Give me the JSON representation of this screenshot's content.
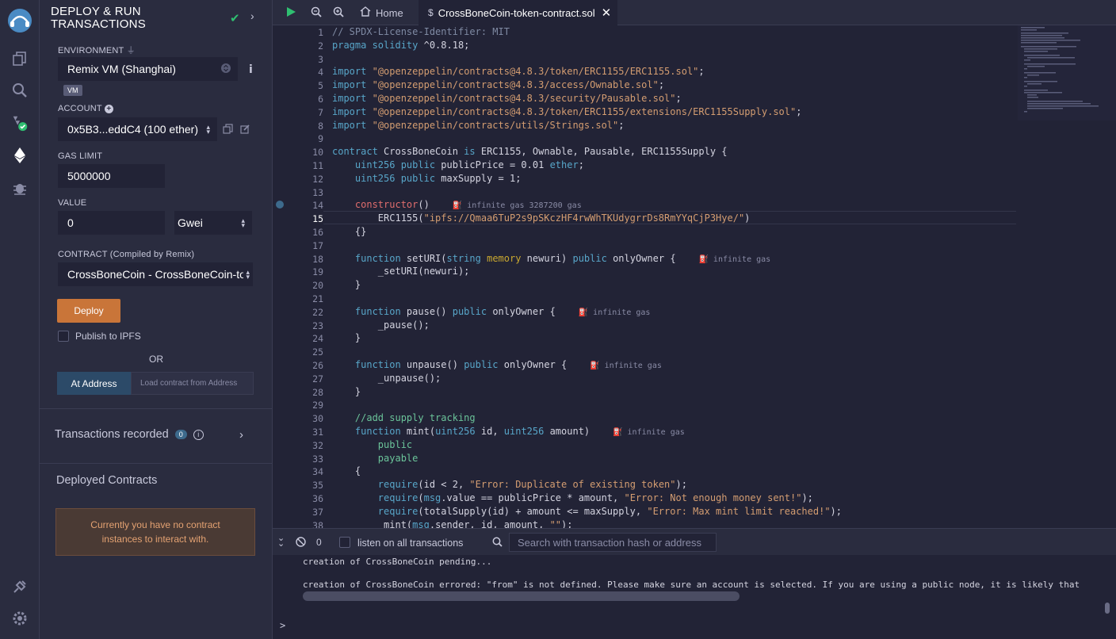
{
  "sidepanel": {
    "title_line1": "DEPLOY & RUN",
    "title_line2": "TRANSACTIONS",
    "environment_label": "ENVIRONMENT",
    "environment_value": "Remix VM (Shanghai)",
    "vm_badge": "VM",
    "account_label": "ACCOUNT",
    "account_value": "0x5B3...eddC4 (100 ether)",
    "gas_limit_label": "GAS LIMIT",
    "gas_limit_value": "5000000",
    "value_label": "VALUE",
    "value_amount": "0",
    "value_unit": "Gwei",
    "contract_label": "CONTRACT",
    "contract_note": "(Compiled by Remix)",
    "contract_value": "CrossBoneCoin - CrossBoneCoin-token",
    "deploy_label": "Deploy",
    "publish_ipfs_label": "Publish to IPFS",
    "or_label": "OR",
    "at_address_label": "At Address",
    "load_address_placeholder": "Load contract from Address",
    "transactions_recorded_label": "Transactions recorded",
    "transactions_count": "0",
    "deployed_contracts_label": "Deployed Contracts",
    "no_instances_line1": "Currently you have no contract",
    "no_instances_line2": "instances to interact with."
  },
  "tabs": {
    "home_label": "Home",
    "file_label": "CrossBoneCoin-token-contract.sol"
  },
  "editor": {
    "line_numbers": [
      "1",
      "2",
      "3",
      "4",
      "5",
      "6",
      "7",
      "8",
      "9",
      "10",
      "11",
      "12",
      "13",
      "14",
      "15",
      "16",
      "17",
      "18",
      "19",
      "20",
      "21",
      "22",
      "23",
      "24",
      "25",
      "26",
      "27",
      "28",
      "29",
      "30",
      "31",
      "32",
      "33",
      "34",
      "35",
      "36",
      "37",
      "38"
    ],
    "current_line": 15,
    "gas_hints": {
      "constructor": "infinite gas 3287200 gas",
      "setURI": "infinite gas",
      "pause": "infinite gas",
      "unpause": "infinite gas",
      "mint": "infinite gas"
    }
  },
  "terminal": {
    "pending_count": "0",
    "listen_label": "listen on all transactions",
    "search_placeholder": "Search with transaction hash or address",
    "line1": "creation of CrossBoneCoin pending...",
    "line2": "creation of CrossBoneCoin errored: \"from\" is not defined. Please make sure an account is selected. If you are using a public node, it is likely that no account wi",
    "prompt": ">"
  },
  "colors": {
    "accent_orange": "#c97539",
    "check_green": "#2fbf71",
    "panel_bg": "#2a2c3f",
    "editor_bg": "#222336"
  }
}
